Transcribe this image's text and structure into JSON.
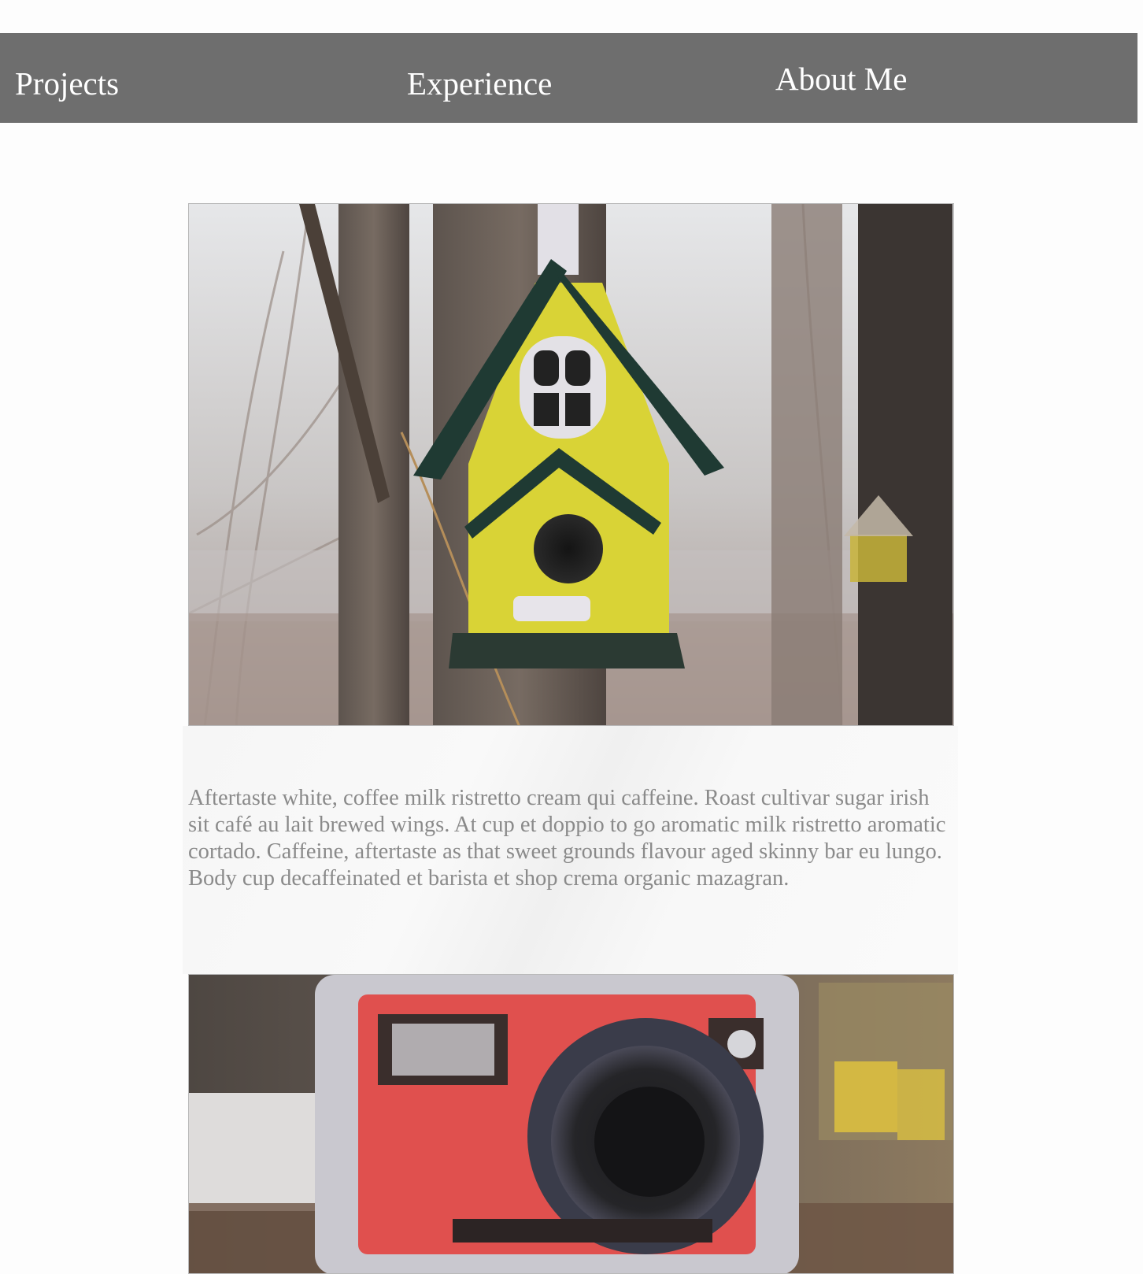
{
  "nav": {
    "projects_label": "Projects",
    "experience_label": "Experience",
    "about_label": "About Me"
  },
  "content": {
    "description": "Aftertaste white, coffee milk ristretto cream qui caffeine. Roast cultivar sugar irish sit café au lait brewed wings. At cup et doppio to go aromatic milk ristretto aromatic cortado. Caffeine, aftertaste as that sweet grounds flavour aged skinny bar  eu lungo. Body cup decaffeinated et barista et shop crema organic mazagran."
  },
  "colors": {
    "navbar_bg": "#6e6e6e",
    "nav_text": "#ffffff",
    "body_text": "#8a8a8a",
    "birdhouse_yellow": "#d9d336",
    "roof_green": "#1f3a33",
    "camera_red": "#e0504e"
  }
}
